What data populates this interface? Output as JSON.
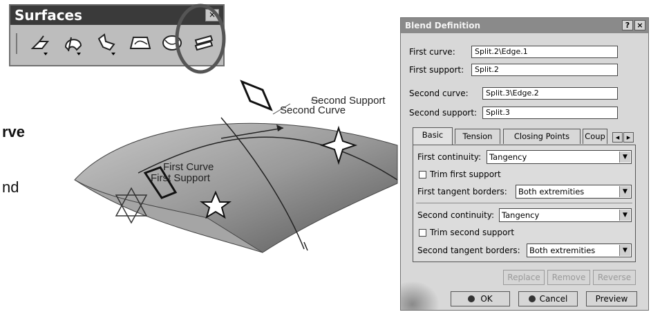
{
  "toolbar": {
    "title": "Surfaces",
    "close_glyph": "×",
    "icons": [
      "extrude-icon",
      "revolve-icon",
      "sweep-icon",
      "fill-icon",
      "multisection-icon",
      "blend-icon"
    ]
  },
  "side_text": {
    "line1": "rve",
    "line2": "nd"
  },
  "scene": {
    "second_support_label": "Second Support",
    "second_curve_label": "Second Curve",
    "first_curve_label": "First Curve",
    "first_support_label": "First Support"
  },
  "dialog": {
    "title": "Blend Definition",
    "help_glyph": "?",
    "close_glyph": "×",
    "first_curve_label": "First curve:",
    "first_curve_value": "Split.2\\Edge.1",
    "first_support_label": "First support:",
    "first_support_value": "Split.2",
    "second_curve_label": "Second curve:",
    "second_curve_value": "Split.3\\Edge.2",
    "second_support_label": "Second support:",
    "second_support_value": "Split.3",
    "tabs": [
      "Basic",
      "Tension",
      "Closing Points",
      "Coup"
    ],
    "tab_prev": "◂",
    "tab_next": "▸",
    "first_continuity_label": "First continuity:",
    "first_continuity_value": "Tangency",
    "trim_first_label": "Trim first support",
    "first_tangent_label": "First tangent borders:",
    "first_tangent_value": "Both extremities",
    "second_continuity_label": "Second continuity:",
    "second_continuity_value": "Tangency",
    "trim_second_label": "Trim second support",
    "second_tangent_label": "Second tangent borders:",
    "second_tangent_value": "Both extremities",
    "replace_label": "Replace",
    "remove_label": "Remove",
    "reverse_label": "Reverse",
    "ok_label": "OK",
    "cancel_label": "Cancel",
    "preview_label": "Preview"
  }
}
